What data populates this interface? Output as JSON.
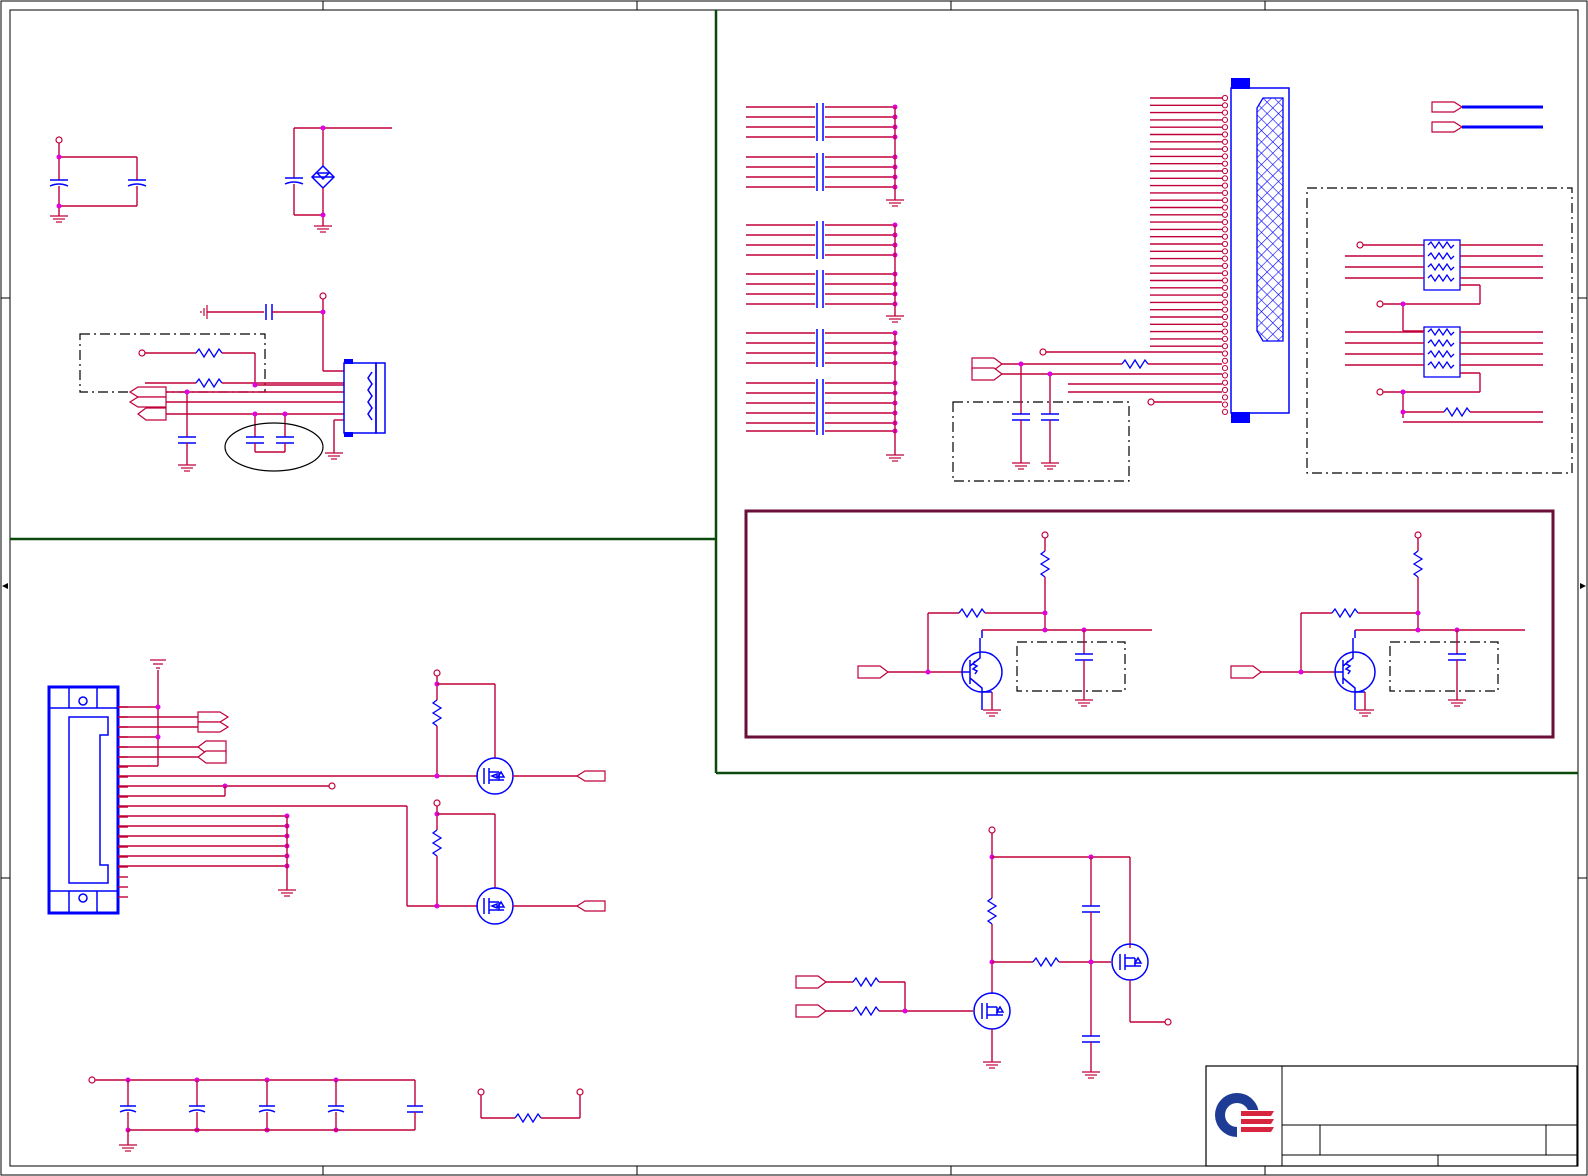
{
  "sheet": {
    "title": "",
    "border_color": "#000000",
    "wire_color": "#c0003a",
    "component_color": "#0000ff",
    "junction_color": "#e000e0",
    "section_border_color": "#0b4a0b",
    "highlight_box_color": "#6a0e3a"
  },
  "logo": {
    "colors": [
      "#1e3c96",
      "#d7263d"
    ]
  },
  "title_block": {
    "company": "",
    "title": "",
    "size": "",
    "document_number": "",
    "rev": ""
  }
}
